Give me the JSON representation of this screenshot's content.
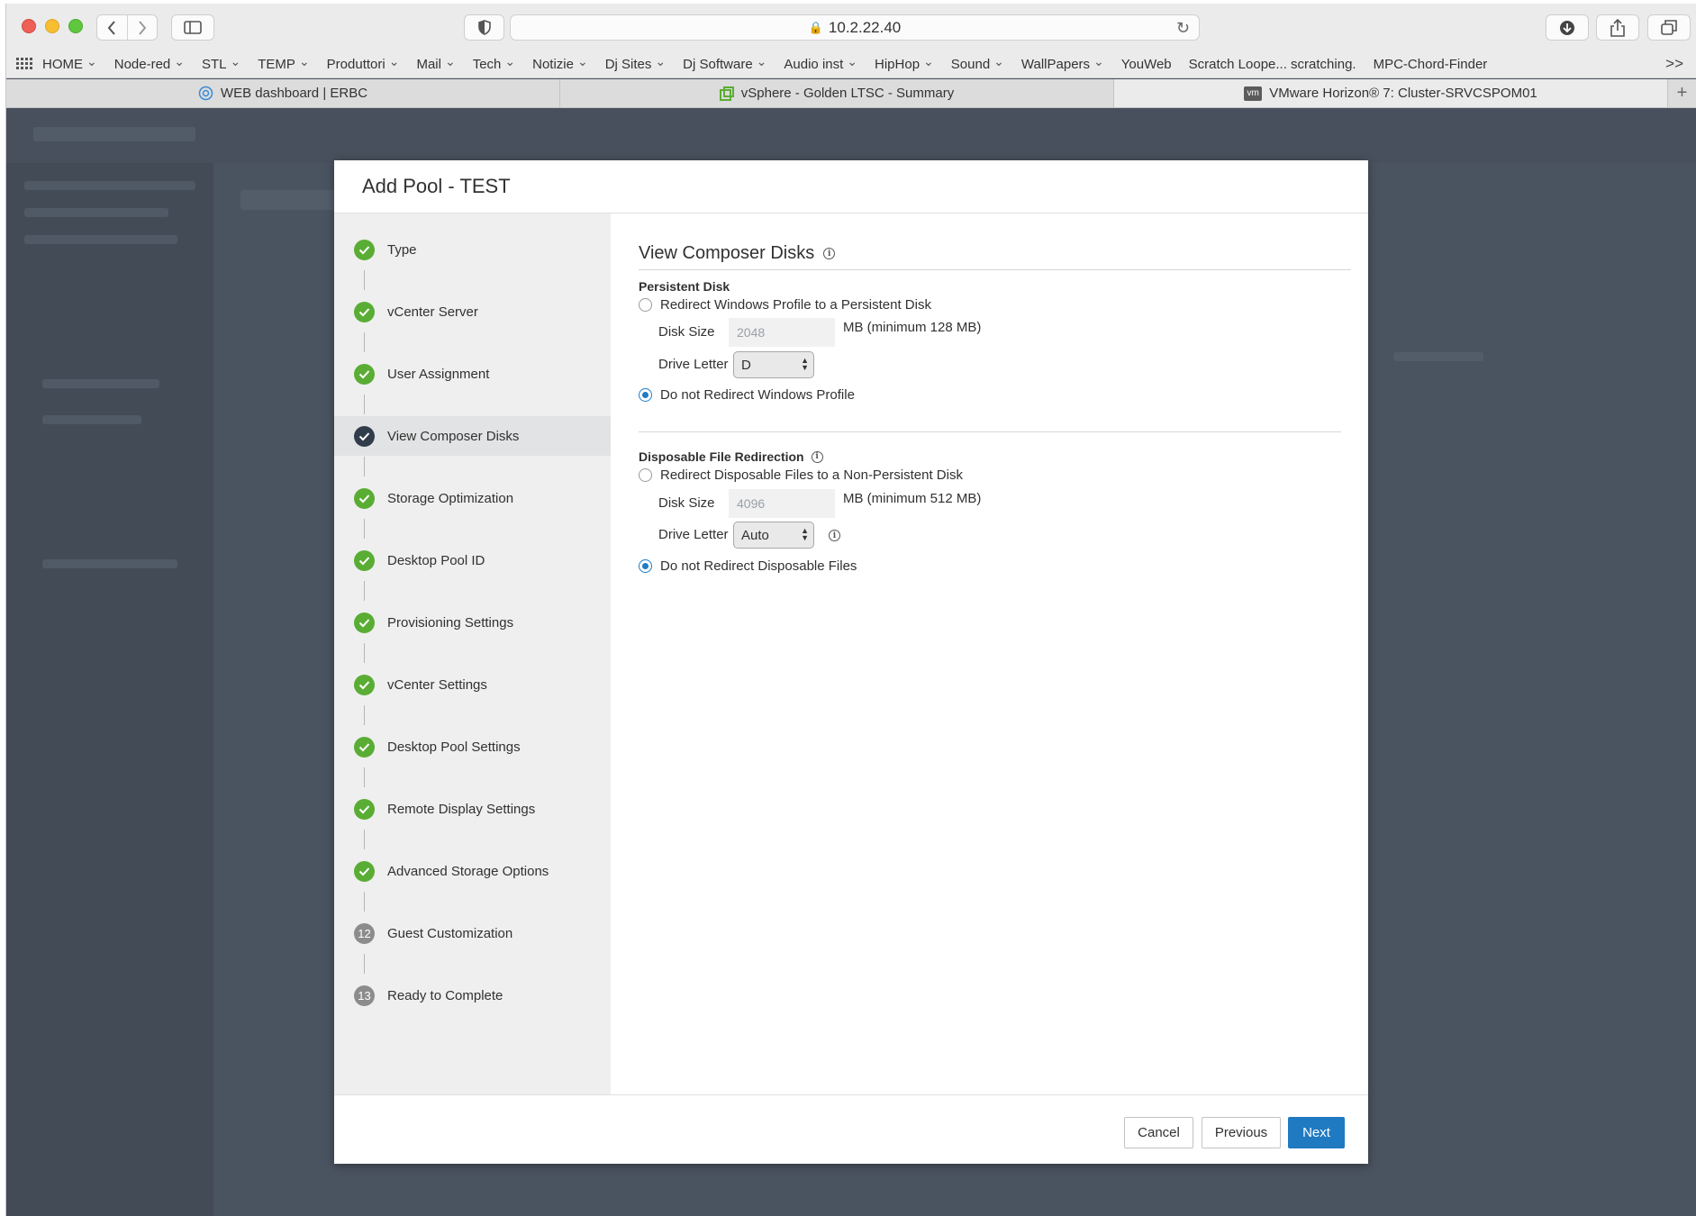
{
  "browser": {
    "url": "10.2.22.40",
    "bookmarks": [
      {
        "label": "HOME",
        "dropdown": true
      },
      {
        "label": "Node-red",
        "dropdown": true
      },
      {
        "label": "STL",
        "dropdown": true
      },
      {
        "label": "TEMP",
        "dropdown": true
      },
      {
        "label": "Produttori",
        "dropdown": true
      },
      {
        "label": "Mail",
        "dropdown": true
      },
      {
        "label": "Tech",
        "dropdown": true
      },
      {
        "label": "Notizie",
        "dropdown": true
      },
      {
        "label": "Dj Sites",
        "dropdown": true
      },
      {
        "label": "Dj Software",
        "dropdown": true
      },
      {
        "label": "Audio inst",
        "dropdown": true
      },
      {
        "label": "HipHop",
        "dropdown": true
      },
      {
        "label": "Sound",
        "dropdown": true
      },
      {
        "label": "WallPapers",
        "dropdown": true
      },
      {
        "label": "YouWeb",
        "dropdown": false
      },
      {
        "label": "Scratch Loope... scratching.",
        "dropdown": false
      },
      {
        "label": "MPC-Chord-Finder",
        "dropdown": false
      }
    ],
    "more_label": ">>",
    "tabs": [
      {
        "label": "WEB dashboard | ERBC",
        "icon": "gear-icon",
        "active": false
      },
      {
        "label": "vSphere - Golden LTSC - Summary",
        "icon": "vsphere-icon",
        "active": false
      },
      {
        "label": "VMware Horizon® 7: Cluster-SRVCSPOM01",
        "icon": "vm-icon",
        "icon_text": "vm",
        "active": true
      }
    ],
    "new_tab_label": "+"
  },
  "modal": {
    "title": "Add Pool - TEST",
    "steps": [
      {
        "label": "Type",
        "status": "done"
      },
      {
        "label": "vCenter Server",
        "status": "done"
      },
      {
        "label": "User Assignment",
        "status": "done"
      },
      {
        "label": "View Composer Disks",
        "status": "current"
      },
      {
        "label": "Storage Optimization",
        "status": "done"
      },
      {
        "label": "Desktop Pool ID",
        "status": "done"
      },
      {
        "label": "Provisioning Settings",
        "status": "done"
      },
      {
        "label": "vCenter Settings",
        "status": "done"
      },
      {
        "label": "Desktop Pool Settings",
        "status": "done"
      },
      {
        "label": "Remote Display Settings",
        "status": "done"
      },
      {
        "label": "Advanced Storage Options",
        "status": "done"
      },
      {
        "label": "Guest Customization",
        "status": "pending",
        "number": "12"
      },
      {
        "label": "Ready to Complete",
        "status": "pending",
        "number": "13"
      }
    ],
    "section_title": "View Composer Disks",
    "persistent": {
      "heading": "Persistent Disk",
      "redirect_option": "Redirect Windows Profile to a Persistent Disk",
      "disk_size_label": "Disk Size",
      "disk_size_value": "2048",
      "disk_size_unit": "MB (minimum 128 MB)",
      "drive_letter_label": "Drive Letter",
      "drive_letter_value": "D",
      "no_redirect_option": "Do not Redirect Windows Profile",
      "selected": "no_redirect"
    },
    "disposable": {
      "heading": "Disposable File Redirection",
      "redirect_option": "Redirect Disposable Files to a Non-Persistent Disk",
      "disk_size_label": "Disk Size",
      "disk_size_value": "4096",
      "disk_size_unit": "MB (minimum 512 MB)",
      "drive_letter_label": "Drive Letter",
      "drive_letter_value": "Auto",
      "no_redirect_option": "Do not Redirect Disposable Files",
      "selected": "no_redirect"
    },
    "buttons": {
      "cancel": "Cancel",
      "previous": "Previous",
      "next": "Next"
    }
  },
  "colors": {
    "accent": "#1f7ac2",
    "step_done": "#5aad34",
    "step_current": "#313d4a",
    "step_pending": "#8c8c8c",
    "overlay": "#4a5360"
  }
}
